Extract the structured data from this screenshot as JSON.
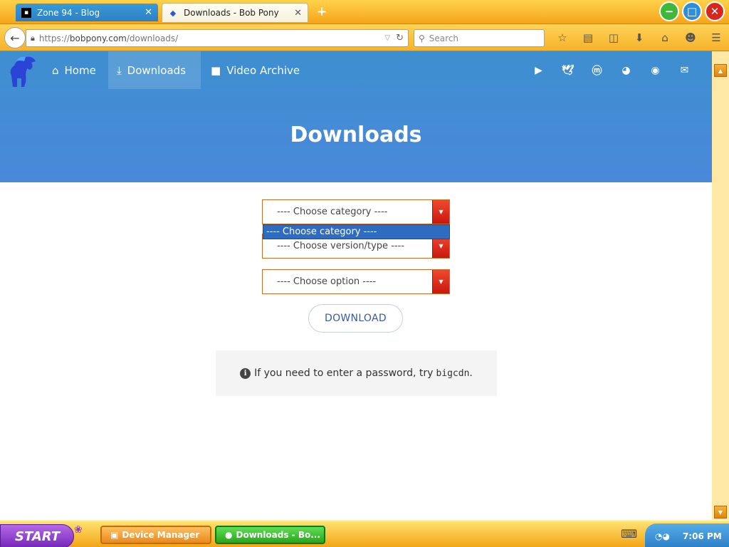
{
  "tabs": [
    {
      "title": "Zone 94 - Blog",
      "close": "✕"
    },
    {
      "title": "Downloads - Bob Pony",
      "close": "✕"
    }
  ],
  "new_tab": "+",
  "window": {
    "minimize": "−",
    "maximize": "□",
    "close": "✕"
  },
  "urlbar": {
    "prefix": "https://",
    "host": "bobpony.com",
    "path": "/downloads/"
  },
  "searchbar": {
    "placeholder": "Search"
  },
  "toolbar_icons": [
    "bookmark-star-icon",
    "reading-list-icon",
    "pocket-icon",
    "downloads-icon",
    "home-icon",
    "chat-icon",
    "menu-icon"
  ],
  "site": {
    "nav": [
      {
        "label": "Home",
        "icon": "home-icon"
      },
      {
        "label": "Downloads",
        "icon": "download-icon"
      },
      {
        "label": "Video Archive",
        "icon": "video-camera-icon"
      }
    ],
    "social": [
      "youtube-icon",
      "twitter-icon",
      "mastodon-icon",
      "discord-icon",
      "github-icon",
      "mail-icon"
    ],
    "title": "Downloads"
  },
  "form": {
    "category_select": "---- Choose category ----",
    "category_dropdown_option": "---- Choose category ----",
    "version_select": "---- Choose version/type ----",
    "option_select": "---- Choose option ----",
    "download_button": "DOWNLOAD"
  },
  "note": {
    "text": "If you need to enter a password, try",
    "code": "bigcdn",
    "suffix": "."
  },
  "taskbar": {
    "start": "START",
    "tasks": [
      "Device Manager",
      "Downloads - Bo..."
    ],
    "clock": "7:06 PM"
  },
  "colors": {
    "header_blue": "#4a88da",
    "select_border": "#c5702a",
    "arrow_red": "#d9261a",
    "taskbar_orange": "#f2a516"
  }
}
